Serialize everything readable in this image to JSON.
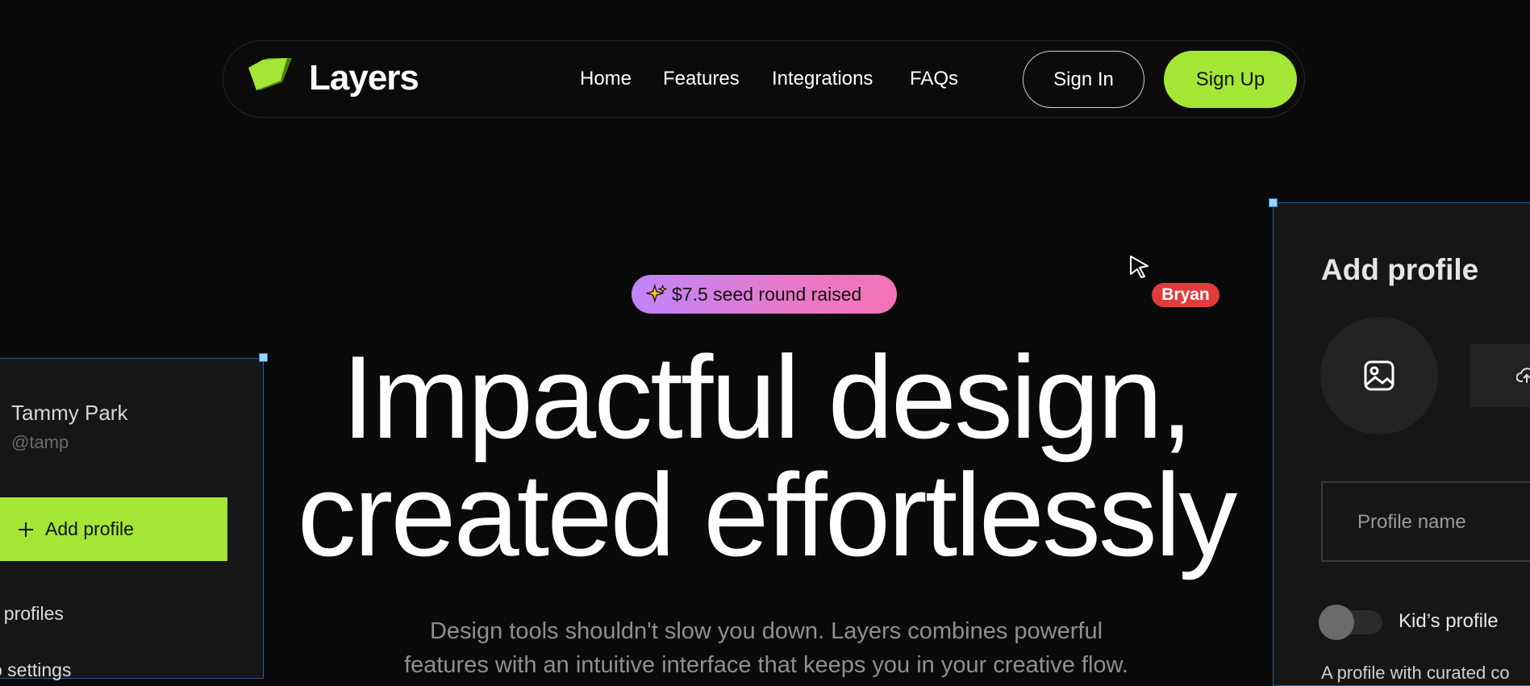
{
  "nav": {
    "brand": "Layers",
    "links": [
      "Home",
      "Features",
      "Integrations",
      "FAQs"
    ],
    "sign_in": "Sign In",
    "sign_up": "Sign Up"
  },
  "badge": {
    "icon": "sparkles-icon",
    "text": "$7.5 seed round raised"
  },
  "hero": {
    "title_line1": "Impactful design,",
    "title_line2": "created effortlessly",
    "subtitle_line1": "Design tools shouldn't slow you down. Layers combines powerful",
    "subtitle_line2": "features with an intuitive interface that keeps you in your creative flow."
  },
  "cursor": {
    "user": "Bryan"
  },
  "left_card": {
    "name": "Tammy Park",
    "handle": "@tamp",
    "add_button": "Add profile",
    "items": [
      "t profiles",
      "o settings"
    ]
  },
  "right_card": {
    "title": "Add profile",
    "name_placeholder": "Profile name",
    "kid_label": "Kid’s profile",
    "description": "A profile with curated co"
  },
  "colors": {
    "accent": "#a3e635",
    "background": "#0a0a0a",
    "cursor_tag": "#e23b3b"
  }
}
